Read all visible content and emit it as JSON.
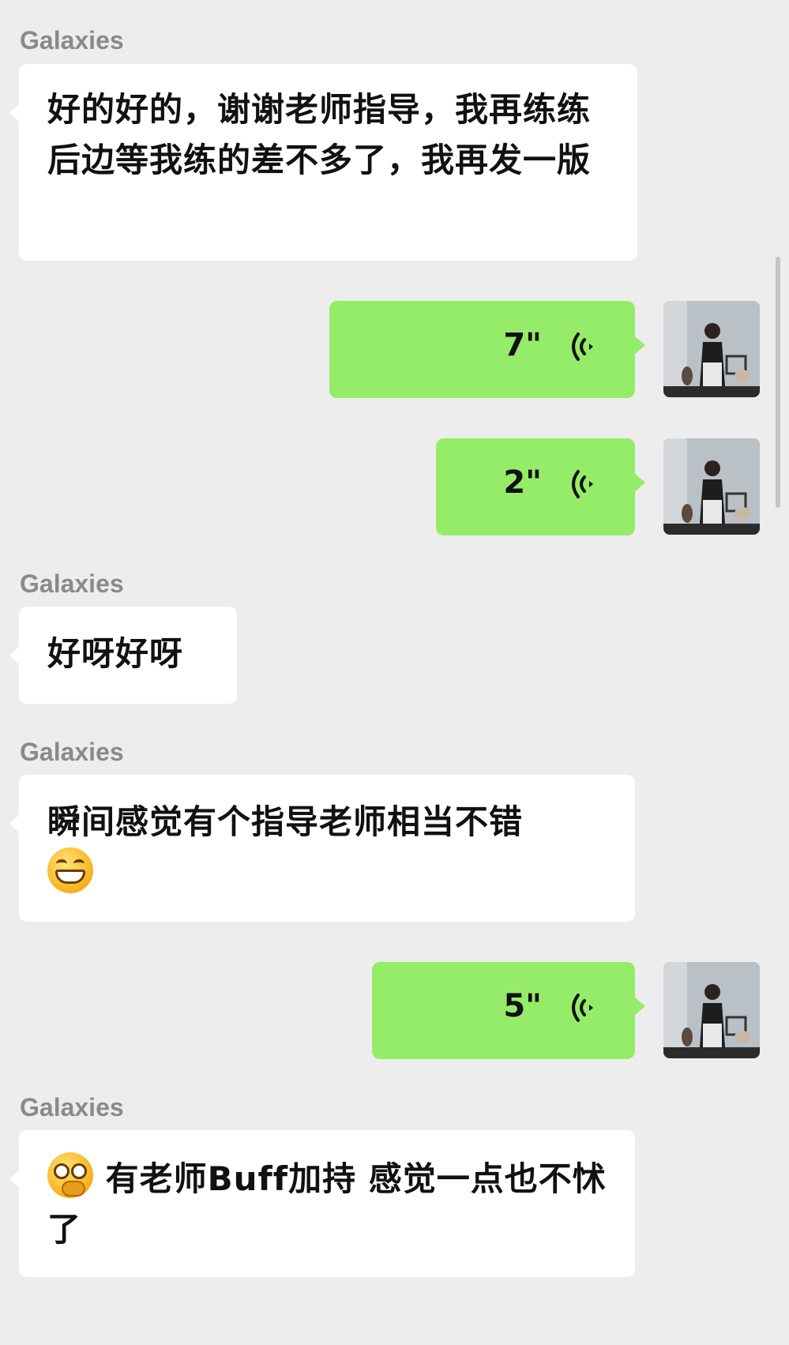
{
  "chat": {
    "messages": [
      {
        "type": "text-in",
        "sender": "Galaxies",
        "text": "好的好的，谢谢老师指导，我再练练后边等我练的差不多了，我再发一版"
      },
      {
        "type": "voice-out",
        "duration": "7\""
      },
      {
        "type": "voice-out",
        "duration": "2\""
      },
      {
        "type": "text-in",
        "sender": "Galaxies",
        "text": "好呀好呀"
      },
      {
        "type": "text-in",
        "sender": "Galaxies",
        "text": "瞬间感觉有个指导老师相当不错",
        "emoji_after": "grinning-face-emoji"
      },
      {
        "type": "voice-out",
        "duration": "5\""
      },
      {
        "type": "text-in",
        "sender": "Galaxies",
        "emoji_before": "thinking-face-emoji",
        "text": "有老师Buff加持 感觉一点也不怵了"
      }
    ]
  },
  "colors": {
    "background": "#ededed",
    "incoming_bubble": "#ffffff",
    "outgoing_bubble": "#95ec69",
    "sender_name": "#8a8a8a"
  },
  "icons": {
    "voice": "voice-wave-icon",
    "avatar": "user-avatar-photo"
  }
}
